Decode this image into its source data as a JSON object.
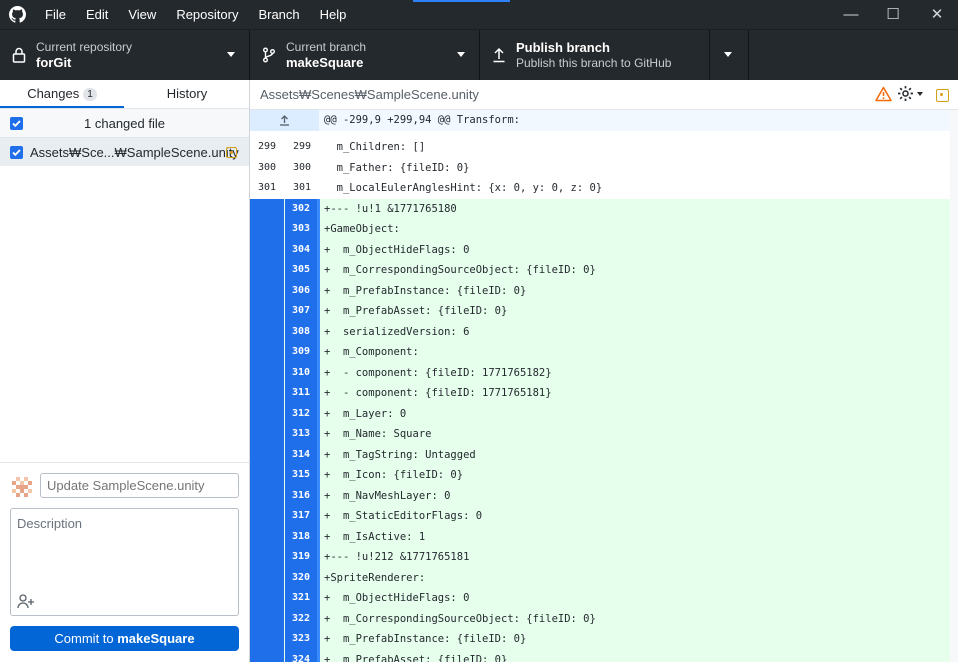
{
  "window": {
    "menu": [
      "File",
      "Edit",
      "View",
      "Repository",
      "Branch",
      "Help"
    ],
    "controls": {
      "minimize": "—",
      "maximize": "☐",
      "close": "✕"
    }
  },
  "toolbar": {
    "repo_caption": "Current repository",
    "repo_name": "forGit",
    "branch_caption": "Current branch",
    "branch_name": "makeSquare",
    "publish_title": "Publish branch",
    "publish_caption": "Publish this branch to GitHub"
  },
  "sidebar": {
    "tab_changes": "Changes",
    "changes_count": "1",
    "tab_history": "History",
    "changed_files_label": "1 changed file",
    "file_path": "Assets₩Sce...₩SampleScene.unity"
  },
  "commit": {
    "summary_placeholder": "Update SampleScene.unity",
    "description_placeholder": "Description",
    "button_prefix": "Commit to ",
    "button_branch": "makeSquare"
  },
  "diff": {
    "path": "Assets₩Scenes₩SampleScene.unity",
    "hunk_header": "@@ -299,9 +299,94 @@ Transform:",
    "lines": [
      {
        "type": "ctx",
        "old": "299",
        "new": "299",
        "text": "  m_Children: []"
      },
      {
        "type": "ctx",
        "old": "300",
        "new": "300",
        "text": "  m_Father: {fileID: 0}"
      },
      {
        "type": "ctx",
        "old": "301",
        "new": "301",
        "text": "  m_LocalEulerAnglesHint: {x: 0, y: 0, z: 0}"
      },
      {
        "type": "add",
        "old": "",
        "new": "302",
        "text": "+--- !u!1 &1771765180"
      },
      {
        "type": "add",
        "old": "",
        "new": "303",
        "text": "+GameObject:"
      },
      {
        "type": "add",
        "old": "",
        "new": "304",
        "text": "+  m_ObjectHideFlags: 0"
      },
      {
        "type": "add",
        "old": "",
        "new": "305",
        "text": "+  m_CorrespondingSourceObject: {fileID: 0}"
      },
      {
        "type": "add",
        "old": "",
        "new": "306",
        "text": "+  m_PrefabInstance: {fileID: 0}"
      },
      {
        "type": "add",
        "old": "",
        "new": "307",
        "text": "+  m_PrefabAsset: {fileID: 0}"
      },
      {
        "type": "add",
        "old": "",
        "new": "308",
        "text": "+  serializedVersion: 6"
      },
      {
        "type": "add",
        "old": "",
        "new": "309",
        "text": "+  m_Component:"
      },
      {
        "type": "add",
        "old": "",
        "new": "310",
        "text": "+  - component: {fileID: 1771765182}"
      },
      {
        "type": "add",
        "old": "",
        "new": "311",
        "text": "+  - component: {fileID: 1771765181}"
      },
      {
        "type": "add",
        "old": "",
        "new": "312",
        "text": "+  m_Layer: 0"
      },
      {
        "type": "add",
        "old": "",
        "new": "313",
        "text": "+  m_Name: Square"
      },
      {
        "type": "add",
        "old": "",
        "new": "314",
        "text": "+  m_TagString: Untagged"
      },
      {
        "type": "add",
        "old": "",
        "new": "315",
        "text": "+  m_Icon: {fileID: 0}"
      },
      {
        "type": "add",
        "old": "",
        "new": "316",
        "text": "+  m_NavMeshLayer: 0"
      },
      {
        "type": "add",
        "old": "",
        "new": "317",
        "text": "+  m_StaticEditorFlags: 0"
      },
      {
        "type": "add",
        "old": "",
        "new": "318",
        "text": "+  m_IsActive: 1"
      },
      {
        "type": "add",
        "old": "",
        "new": "319",
        "text": "+--- !u!212 &1771765181"
      },
      {
        "type": "add",
        "old": "",
        "new": "320",
        "text": "+SpriteRenderer:"
      },
      {
        "type": "add",
        "old": "",
        "new": "321",
        "text": "+  m_ObjectHideFlags: 0"
      },
      {
        "type": "add",
        "old": "",
        "new": "322",
        "text": "+  m_CorrespondingSourceObject: {fileID: 0}"
      },
      {
        "type": "add",
        "old": "",
        "new": "323",
        "text": "+  m_PrefabInstance: {fileID: 0}"
      },
      {
        "type": "add",
        "old": "",
        "new": "324",
        "text": "+  m_PrefabAsset: {fileID: 0}"
      }
    ]
  },
  "colors": {
    "titlebar": "#24292e",
    "accent": "#0366d6",
    "added_gutter": "#1f6feb",
    "added_background": "#e6ffed",
    "warning": "#f66a0a",
    "modified": "#d4a017"
  }
}
